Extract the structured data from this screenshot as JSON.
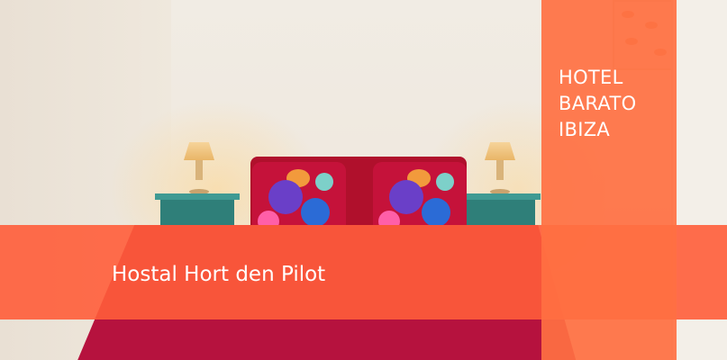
{
  "side_panel": {
    "lines": [
      "HOTEL",
      "BARATO",
      "IBIZA"
    ]
  },
  "banner": {
    "title": "Hostal Hort den Pilot"
  },
  "colors": {
    "accent_orange": "#ff6a3d",
    "bed_red": "#b6123e",
    "nightstand_teal": "#2f7f79"
  }
}
